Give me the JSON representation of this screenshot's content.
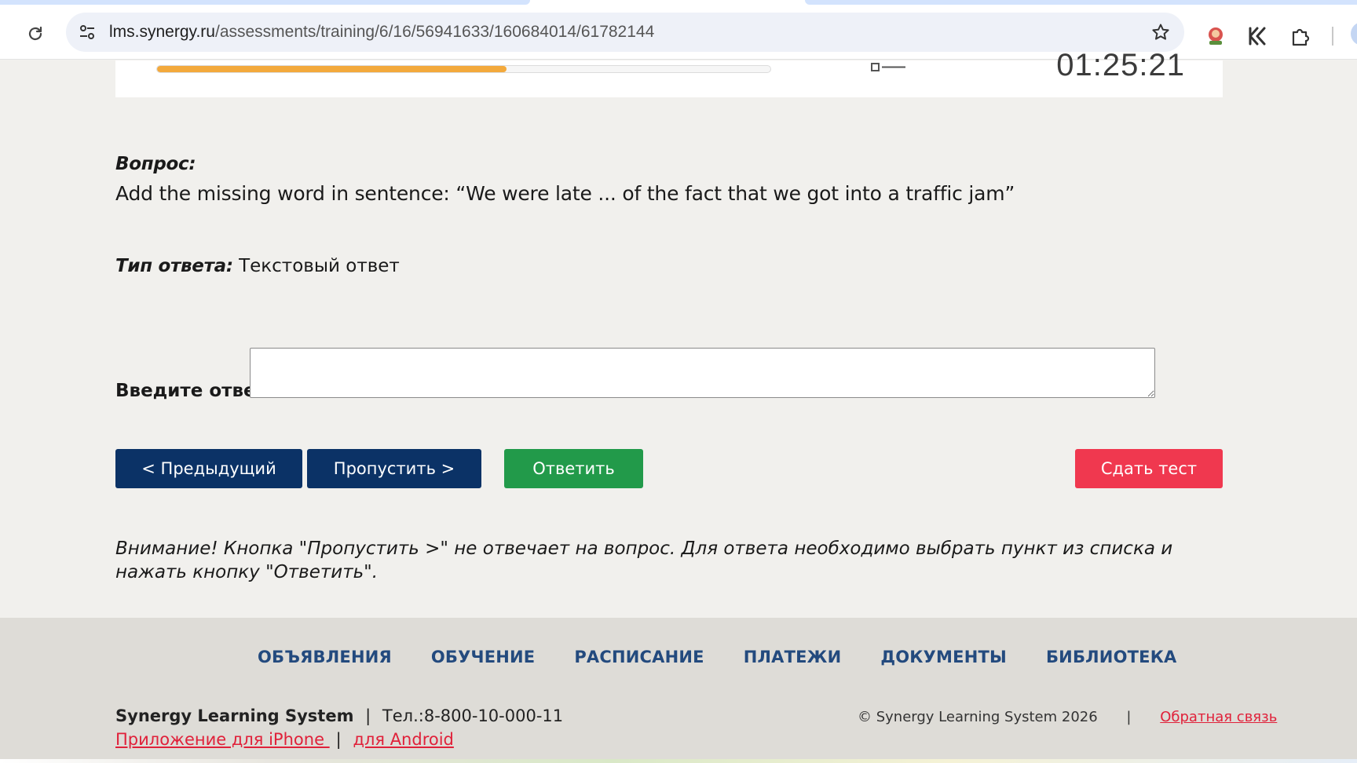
{
  "browser": {
    "url_host": "lms.synergy.ru",
    "url_path": "/assessments/training/6/16/56941633/160684014/61782144"
  },
  "header": {
    "progress_fraction": 0.57,
    "timer": "01:25:21"
  },
  "question": {
    "label": "Вопрос:",
    "text": "Add the missing word in sentence: “We were late ... of the fact that we got into a traffic jam”",
    "type_label": "Тип ответа:",
    "type_value": "Текстовый ответ",
    "answer_label": "Введите ответ:",
    "answer_value": ""
  },
  "buttons": {
    "prev": "< Предыдущий",
    "skip": "Пропустить >",
    "answer": "Ответить",
    "submit": "Сдать тест"
  },
  "warning": "Внимание! Кнопка \"Пропустить >\" не отвечает на вопрос. Для ответа необходимо выбрать пункт из списка и нажать кнопку \"Ответить\".",
  "footer": {
    "nav": [
      "ОБЪЯВЛЕНИЯ",
      "ОБУЧЕНИЕ",
      "РАСПИСАНИЕ",
      "ПЛАТЕЖИ",
      "ДОКУМЕНТЫ",
      "БИБЛИОТЕКА"
    ],
    "brand": "Synergy Learning System",
    "sep": "|",
    "phone": "Тел.:8-800-10-000-11",
    "app_iphone": "Приложение для iPhone ",
    "app_android": "для Android",
    "copyright": "© Synergy Learning System 2026",
    "feedback": "Обратная связь"
  },
  "colors": {
    "primary": "#0b3266",
    "success": "#229a4a",
    "danger": "#f0384f",
    "progress": "#f3a93c",
    "link": "#e0213a",
    "nav": "#234a7e"
  },
  "icons": [
    "reload-icon",
    "site-settings-icon",
    "bookmark-star-icon",
    "extension-avatar-icon",
    "extension-k-icon",
    "extensions-puzzle-icon",
    "question-list-icon"
  ]
}
